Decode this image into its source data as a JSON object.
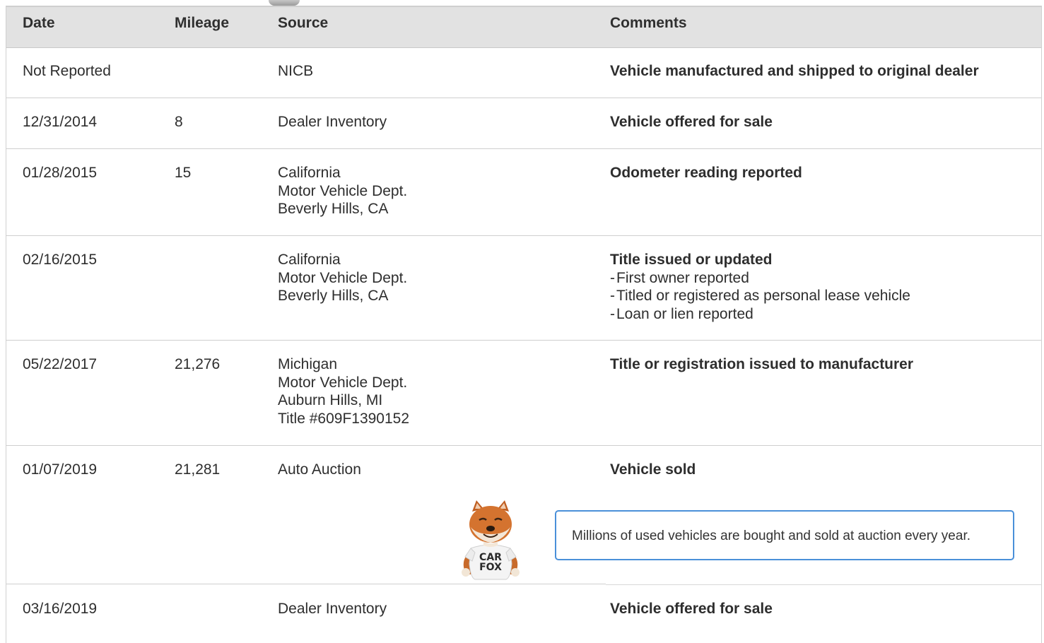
{
  "columns": {
    "date": "Date",
    "mileage": "Mileage",
    "source": "Source",
    "comments": "Comments"
  },
  "rows": [
    {
      "date": "Not Reported",
      "mileage": "",
      "source": [
        "NICB"
      ],
      "comment_title": "Vehicle manufactured and shipped to original dealer",
      "comment_details": []
    },
    {
      "date": "12/31/2014",
      "mileage": "8",
      "source": [
        "Dealer Inventory"
      ],
      "comment_title": "Vehicle offered for sale",
      "comment_details": []
    },
    {
      "date": "01/28/2015",
      "mileage": "15",
      "source": [
        "California",
        "Motor Vehicle Dept.",
        "Beverly Hills, CA"
      ],
      "comment_title": "Odometer reading reported",
      "comment_details": []
    },
    {
      "date": "02/16/2015",
      "mileage": "",
      "source": [
        "California",
        "Motor Vehicle Dept.",
        "Beverly Hills, CA"
      ],
      "comment_title": "Title issued or updated",
      "comment_details": [
        "First owner reported",
        "Titled or registered as personal lease vehicle",
        "Loan or lien reported"
      ]
    },
    {
      "date": "05/22/2017",
      "mileage": "21,276",
      "source": [
        "Michigan",
        "Motor Vehicle Dept.",
        "Auburn Hills, MI",
        "Title #609F1390152"
      ],
      "comment_title": "Title or registration issued to manufacturer",
      "comment_details": []
    },
    {
      "date": "01/07/2019",
      "mileage": "21,281",
      "source": [
        "Auto Auction"
      ],
      "comment_title": "Vehicle sold",
      "comment_details": []
    },
    {
      "date": "03/16/2019",
      "mileage": "",
      "source": [
        "Dealer Inventory"
      ],
      "comment_title": "Vehicle offered for sale",
      "comment_details": []
    }
  ],
  "callout": {
    "text": "Millions of used vehicles are bought and sold at auction every year."
  },
  "mascot": {
    "icon": "carfox-mascot-icon",
    "shirt_line1": "CAR",
    "shirt_line2": "FOX"
  }
}
